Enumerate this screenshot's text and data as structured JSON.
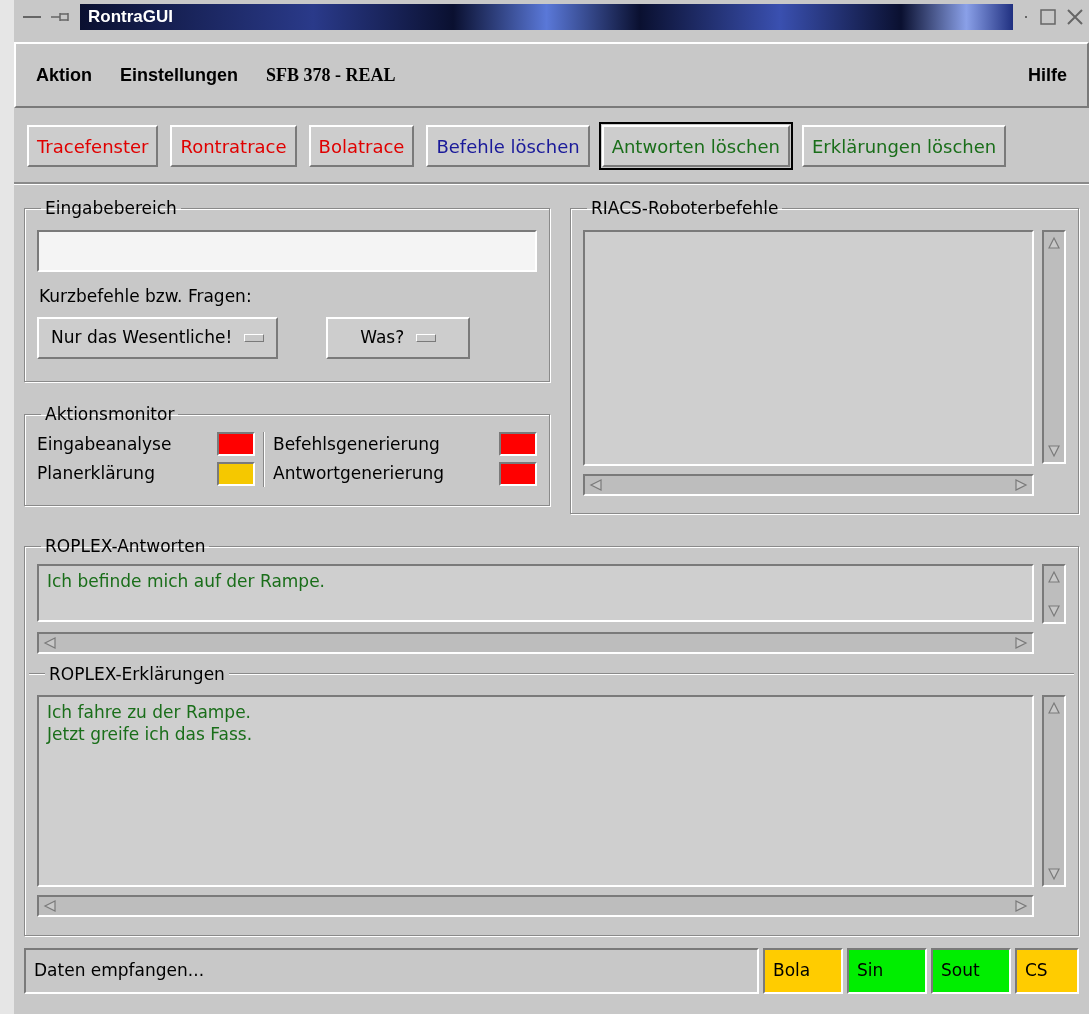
{
  "window": {
    "title": "RontraGUI"
  },
  "menu": [
    {
      "label": "Aktion",
      "kind": "menu"
    },
    {
      "label": "Einstellungen",
      "kind": "menu"
    },
    {
      "label": "SFB 378 - REAL",
      "kind": "mode"
    }
  ],
  "help": "Hilfe",
  "toolbar": [
    {
      "label": "Tracefenster",
      "color": "#e00000",
      "focused": false
    },
    {
      "label": "Rontratrace",
      "color": "#e00000",
      "focused": false
    },
    {
      "label": "Bolatrace",
      "color": "#e00000",
      "focused": false
    },
    {
      "label": "Befehle löschen",
      "color": "#1a1a9a",
      "focused": false
    },
    {
      "label": "Antworten löschen",
      "color": "#1a6e1a",
      "focused": true
    },
    {
      "label": "Erklärungen löschen",
      "color": "#1a6e1a",
      "focused": false
    }
  ],
  "input_area": {
    "title": "Eingabebereich",
    "label": "Kurzbefehle bzw. Fragen:",
    "dropdowns": [
      "Nur das Wesentliche!",
      "Was?"
    ]
  },
  "monitor": {
    "title": "Aktionsmonitor",
    "indicators": [
      {
        "label": "Eingabeanalyse",
        "color": "#ff0000"
      },
      {
        "label": "Planerklärung",
        "color": "#f5c800"
      },
      {
        "label": "Befehlsgenerierung",
        "color": "#ff0000"
      },
      {
        "label": "Antwortgenerierung",
        "color": "#ff0000"
      }
    ]
  },
  "commands": {
    "title": "RIACS-Roboterbefehle"
  },
  "answers": {
    "title": "ROPLEX-Antworten",
    "lines": [
      "Ich befinde mich auf der Rampe."
    ]
  },
  "explanations": {
    "title": "ROPLEX-Erklärungen",
    "lines": [
      "Ich fahre zu der Rampe.",
      "Jetzt greife ich das Fass."
    ]
  },
  "status_bar": {
    "message": "Daten empfangen...",
    "indicators": [
      {
        "label": "Bola",
        "color": "#ffcc00"
      },
      {
        "label": "Sin",
        "color": "#00ee00"
      },
      {
        "label": "Sout",
        "color": "#00ee00"
      },
      {
        "label": "CS",
        "color": "#ffcc00"
      }
    ]
  }
}
